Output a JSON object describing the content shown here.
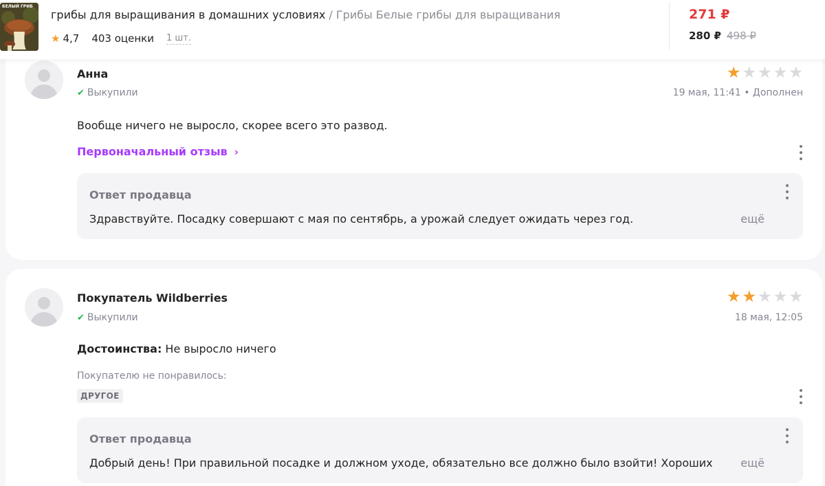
{
  "product": {
    "thumb_label": "БЕЛЫЙ ГРИБ",
    "name": "грибы для выращивания в домашних условиях",
    "separator": " / ",
    "brand_title": "Грибы Белые грибы для выращивания",
    "rating": "4,7",
    "reviews_count": "403 оценки",
    "quantity": "1 шт.",
    "price_main": "271 ₽",
    "price_wallet": "280 ₽",
    "price_old": "498 ₽"
  },
  "reviews": [
    {
      "author": "Анна",
      "bought": "Выкупили",
      "rating": 1,
      "date": "19 мая, 11:41 • Дополнен",
      "text": "Вообще ничего не выросло, скорее всего это развод.",
      "original_link": "Первоначальный отзыв",
      "seller_reply": {
        "title": "Ответ продавца",
        "text": "Здравствуйте. Посадку совершают с мая по сентябрь, а урожай следует ожидать через год.",
        "more": "ещё"
      }
    },
    {
      "author": "Покупатель Wildberries",
      "bought": "Выкупили",
      "rating": 2,
      "date": "18 мая, 12:05",
      "pros_label": "Достоинства:",
      "pros_text": " Не выросло ничего",
      "dislike_label": "Покупателю не понравилось:",
      "tag": "ДРУГОЕ",
      "seller_reply": {
        "title": "Ответ продавца",
        "text": "Добрый день! При правильной посадке и должном уходе, обязательно все должно было взойти! Хороших",
        "more": "ещё"
      }
    }
  ],
  "colors": {
    "accent": "#a73afd",
    "price": "#e33a3a",
    "star": "#f59e2d",
    "check": "#2bb350"
  }
}
